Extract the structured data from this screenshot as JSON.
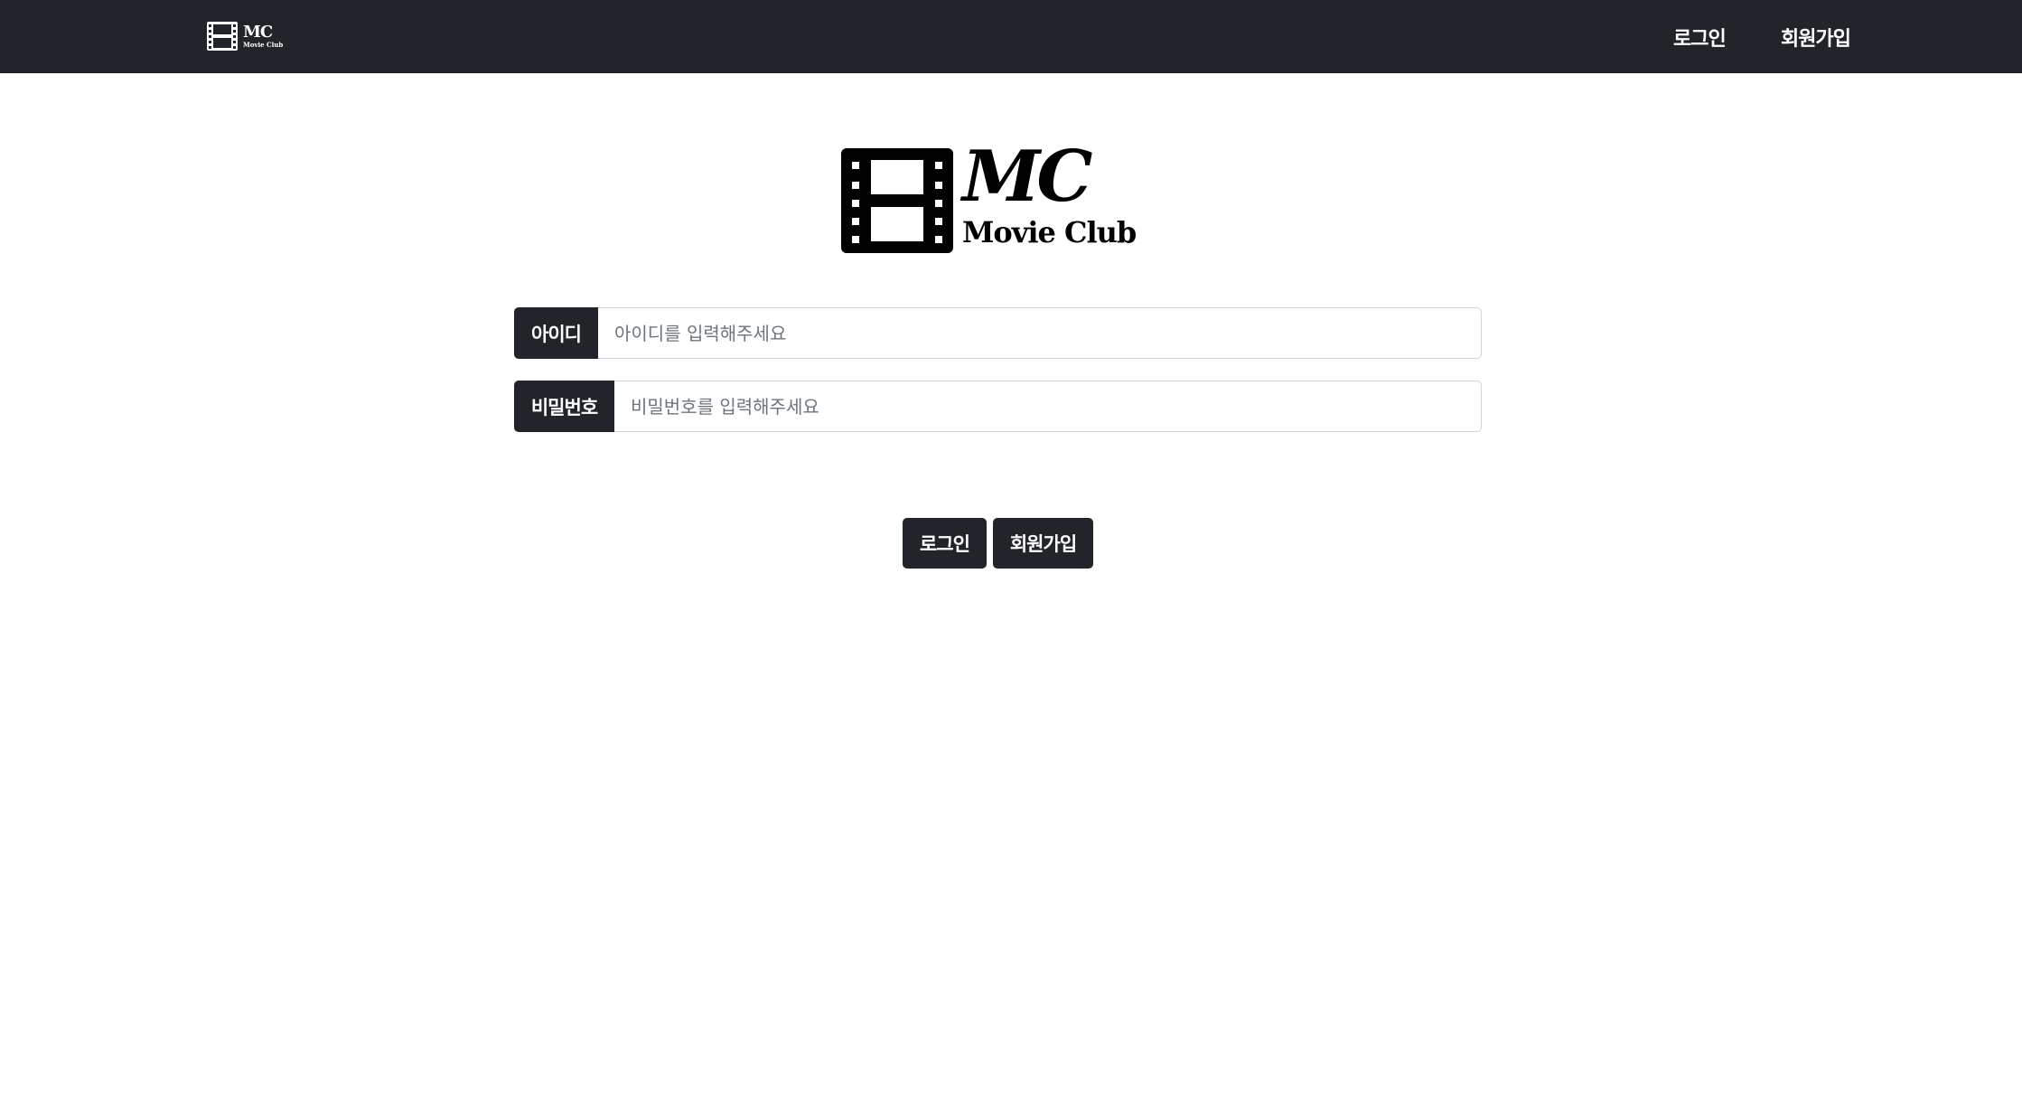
{
  "navbar": {
    "logo": {
      "title": "MC",
      "subtitle": "Movie Club"
    },
    "links": {
      "login": "로그인",
      "signup": "회원가입"
    }
  },
  "hero_logo": {
    "title": "MC",
    "subtitle": "Movie Club"
  },
  "form": {
    "id": {
      "label": "아이디",
      "placeholder": "아이디를 입력해주세요",
      "value": ""
    },
    "password": {
      "label": "비밀번호",
      "placeholder": "비밀번호를 입력해주세요",
      "value": ""
    }
  },
  "buttons": {
    "login": "로그인",
    "signup": "회원가입"
  },
  "colors": {
    "navbar_bg": "#212529",
    "button_bg": "#212529",
    "page_bg": "#ffffff"
  },
  "icons": {
    "logo": "film-reel-icon"
  }
}
